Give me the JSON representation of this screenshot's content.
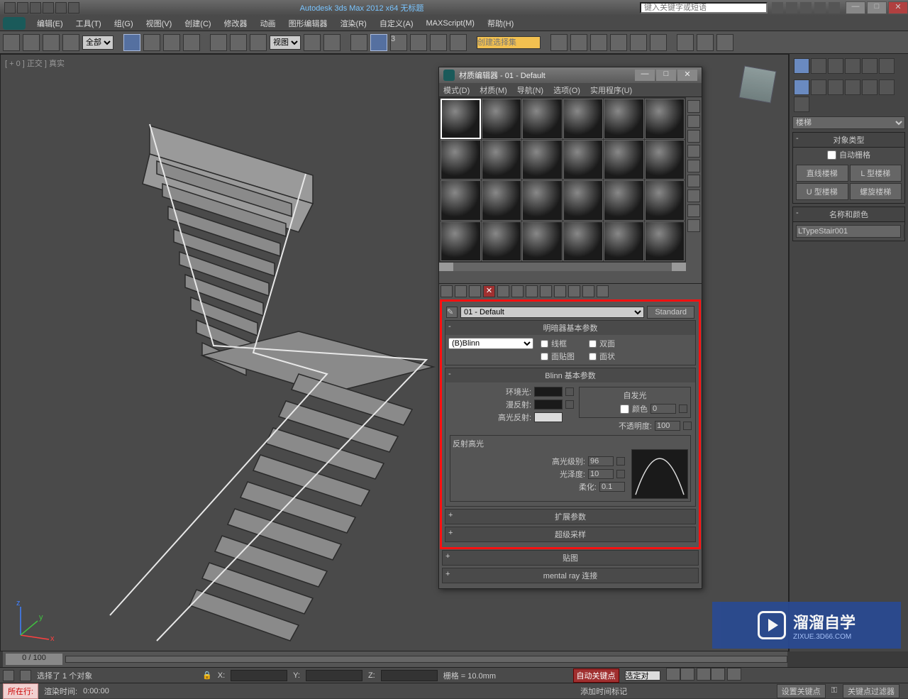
{
  "app": {
    "title": "Autodesk 3ds Max 2012 x64   无标题",
    "search_placeholder": "键入关键字或短语"
  },
  "menubar": [
    "编辑(E)",
    "工具(T)",
    "组(G)",
    "视图(V)",
    "创建(C)",
    "修改器",
    "动画",
    "图形编辑器",
    "渲染(R)",
    "自定义(A)",
    "MAXScript(M)",
    "帮助(H)"
  ],
  "toolbar": {
    "filter": "全部",
    "refsys": "视图",
    "selset_placeholder": "创建选择集"
  },
  "viewport": {
    "label": "[ + 0 ] 正交 ] 真实"
  },
  "right": {
    "category": "楼梯",
    "roll_objtype": "对象类型",
    "autogrid": "自动栅格",
    "btns": [
      "直线楼梯",
      "L 型楼梯",
      "U 型楼梯",
      "螺旋楼梯"
    ],
    "roll_name": "名称和颜色",
    "objname": "LTypeStair001"
  },
  "material_editor": {
    "title": "材质编辑器 - 01 - Default",
    "menus": [
      "模式(D)",
      "材质(M)",
      "导航(N)",
      "选项(O)",
      "实用程序(U)"
    ],
    "mat_name": "01 - Default",
    "mat_type": "Standard",
    "rollouts": {
      "shader": "明暗器基本参数",
      "blinn": "Blinn 基本参数",
      "extended": "扩展参数",
      "super": "超级采样",
      "maps": "贴图",
      "mental": "mental ray 连接"
    },
    "shader_type": "(B)Blinn",
    "checks": {
      "wire": "线框",
      "twosided": "双面",
      "facemap": "面贴图",
      "faceted": "面状"
    },
    "labels": {
      "selfillum": "自发光",
      "color": "颜色",
      "opacity": "不透明度:",
      "ambient": "环境光:",
      "diffuse": "漫反射:",
      "specular": "高光反射:",
      "reflhl": "反射高光",
      "speclevel": "高光级别:",
      "gloss": "光泽度:",
      "soften": "柔化:"
    },
    "values": {
      "selfcolor": "0",
      "opacity": "100",
      "speclevel": "96",
      "gloss": "10",
      "soften": "0.1"
    }
  },
  "timeline": {
    "pos": "0 / 100"
  },
  "status": {
    "selcount": "选择了 1 个对象",
    "x": "X:",
    "y": "Y:",
    "z": "Z:",
    "grid": "栅格 = 10.0mm",
    "autokey": "自动关键点",
    "setkey": "设置关键点",
    "selset": "选定对",
    "keyfilter": "关键点过滤器",
    "addtimemark": "添加时间标记",
    "rendertime_lbl": "渲染时间:",
    "rendertime": "0:00:00",
    "currentrow": "所在行:",
    "lock_icon": "🔒",
    "key_icon": "⚿"
  },
  "watermark": {
    "brand": "溜溜自学",
    "url": "ZIXUE.3D66.COM"
  }
}
